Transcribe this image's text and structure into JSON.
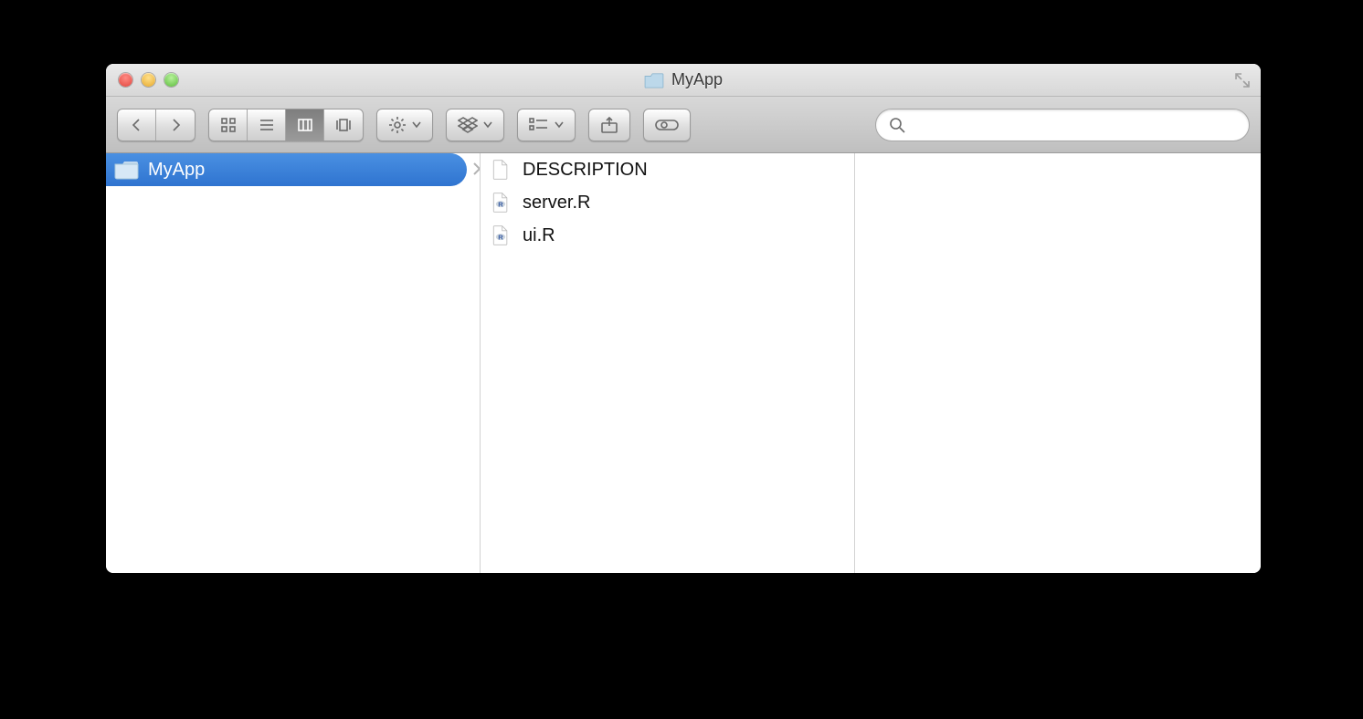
{
  "window": {
    "title": "MyApp"
  },
  "toolbar": {
    "search_placeholder": ""
  },
  "columns": [
    {
      "items": [
        {
          "name": "MyApp",
          "type": "folder",
          "selected": true,
          "hasChildren": true
        }
      ]
    },
    {
      "items": [
        {
          "name": "DESCRIPTION",
          "type": "file-plain"
        },
        {
          "name": "server.R",
          "type": "file-r"
        },
        {
          "name": "ui.R",
          "type": "file-r"
        }
      ]
    },
    {
      "items": []
    }
  ]
}
